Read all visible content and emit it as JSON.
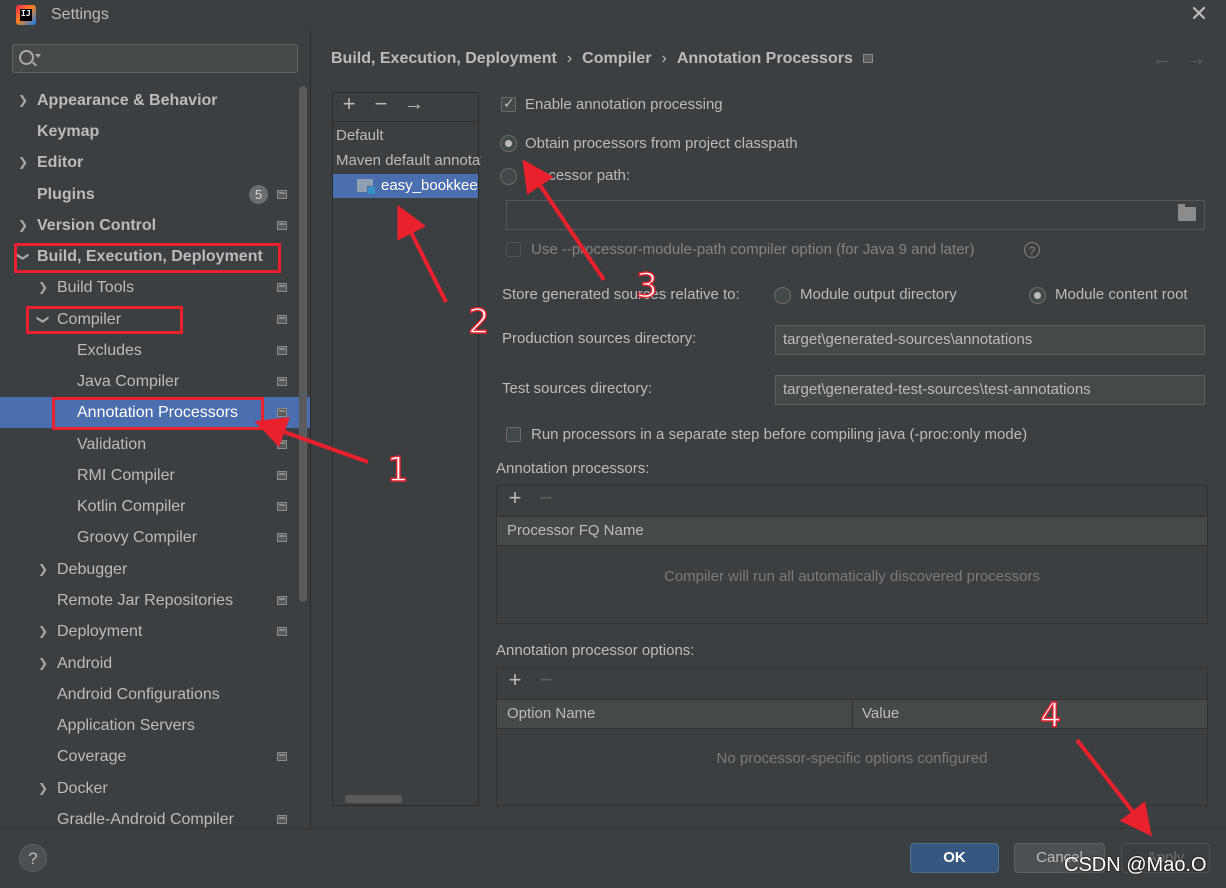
{
  "window": {
    "title": "Settings"
  },
  "sidebar": {
    "search_placeholder": "",
    "items": [
      {
        "label": "Appearance & Behavior",
        "bold": true
      },
      {
        "label": "Keymap",
        "bold": true
      },
      {
        "label": "Editor",
        "bold": true
      },
      {
        "label": "Plugins",
        "bold": true,
        "badge": "5"
      },
      {
        "label": "Version Control",
        "bold": true
      },
      {
        "label": "Build, Execution, Deployment",
        "bold": true
      },
      {
        "label": "Build Tools"
      },
      {
        "label": "Compiler"
      },
      {
        "label": "Excludes"
      },
      {
        "label": "Java Compiler"
      },
      {
        "label": "Annotation Processors",
        "selected": true
      },
      {
        "label": "Validation"
      },
      {
        "label": "RMI Compiler"
      },
      {
        "label": "Kotlin Compiler"
      },
      {
        "label": "Groovy Compiler"
      },
      {
        "label": "Debugger"
      },
      {
        "label": "Remote Jar Repositories"
      },
      {
        "label": "Deployment"
      },
      {
        "label": "Android"
      },
      {
        "label": "Android Configurations"
      },
      {
        "label": "Application Servers"
      },
      {
        "label": "Coverage"
      },
      {
        "label": "Docker"
      },
      {
        "label": "Gradle-Android Compiler"
      }
    ]
  },
  "breadcrumb": [
    "Build, Execution, Deployment",
    "Compiler",
    "Annotation Processors"
  ],
  "profiles": {
    "toolbar": {
      "add": "+",
      "remove": "−",
      "move": "→"
    },
    "items": [
      "Default",
      "Maven default annotation processors profile",
      "easy_bookkeeping"
    ]
  },
  "options": {
    "enable_processing": "Enable annotation processing",
    "obtain_from_classpath": "Obtain processors from project classpath",
    "processor_path": "Processor path:",
    "processor_path_value": "",
    "module_path_option": "Use --processor-module-path compiler option (for Java 9 and later)",
    "store_relative_label": "Store generated sources relative to:",
    "module_output_dir": "Module output directory",
    "module_content_root": "Module content root",
    "production_dir_label": "Production sources directory:",
    "production_dir_value": "target\\generated-sources\\annotations",
    "test_dir_label": "Test sources directory:",
    "test_dir_value": "target\\generated-test-sources\\test-annotations",
    "separate_step": "Run processors in a separate step before compiling java (-proc:only mode)"
  },
  "processors_table": {
    "title": "Annotation processors:",
    "column": "Processor FQ Name",
    "empty": "Compiler will run all automatically discovered processors"
  },
  "options_table": {
    "title": "Annotation processor options:",
    "columns": [
      "Option Name",
      "Value"
    ],
    "empty": "No processor-specific options configured"
  },
  "footer": {
    "help": "?",
    "ok": "OK",
    "cancel": "Cancel",
    "apply": "Apply"
  },
  "annotations": {
    "n1": "1",
    "n2": "2",
    "n3": "3",
    "n4": "4"
  },
  "watermark": "CSDN @Mao.O",
  "colors": {
    "annotation": "#e8212c",
    "selection": "#4b6eaf",
    "background": "#3c3f41"
  }
}
